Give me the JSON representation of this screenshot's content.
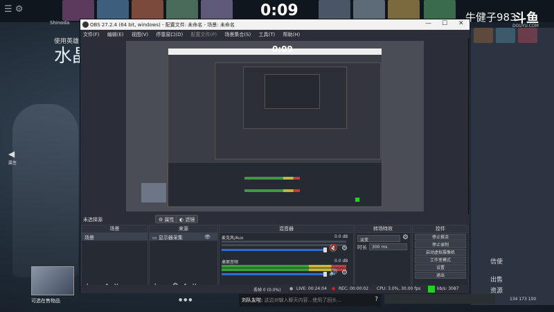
{
  "game": {
    "clock": "0:09",
    "used_hero_label": "使用英雄",
    "hero_name": "水晶",
    "shinoda_label": "Shinoda",
    "left_side_label": "属性",
    "bottom_label": "可选在售物品",
    "right_label_1": "信使",
    "right_label_2": "出售",
    "right_label_3": "资源",
    "right_numbers": "134 173 100"
  },
  "stream": {
    "streamer_name": "牛健子983",
    "platform_logo": "斗鱼",
    "platform_sub": "DOUYU.COM",
    "chat_user": "刘队友啦:",
    "chat_placeholder": "这边对输入聊天内容...使用了回头..."
  },
  "obs": {
    "title": "OBS 27.2.4 (64 bit, windows) - 配置文件: 未命名 - 场景: 未命名",
    "menu": [
      "文件(F)",
      "编辑(E)",
      "视图(V)",
      "停靠窗口(D)",
      "配置文件(P)",
      "场景集合(S)",
      "工具(T)",
      "帮助(H)"
    ],
    "nosource": "未选择源",
    "properties_btn": "属性",
    "filters_btn": "滤镜",
    "docks": {
      "scenes_title": "场景",
      "scenes_items": [
        "场景"
      ],
      "sources_title": "来源",
      "sources_items": [
        "显示器采集"
      ],
      "mixer_title": "混音器",
      "transitions_title": "转场特效",
      "controls_title": "控件"
    },
    "mixer": [
      {
        "name": "麦克风/Aux",
        "db": "0.0 dB",
        "muted": true
      },
      {
        "name": "桌面音频",
        "db": "0.0 dB",
        "muted": false
      }
    ],
    "transitions": {
      "type": "淡变",
      "duration_label": "时长",
      "duration_value": "300 ms"
    },
    "controls": [
      "停止推流",
      "停止录制",
      "启动虚拟摄像机",
      "工作室模式",
      "设置",
      "退出"
    ],
    "status": {
      "dropped": "丢帧 0 (0.0%)",
      "live": "LIVE: 00:24:04",
      "rec": "REC: 00:00:02",
      "cpu": "CPU: 3.0%, 30.00 fps",
      "bitrate": "kb/s: 3087"
    },
    "nested_clock": "0:09",
    "colors": {
      "accent_green": "#1ed51e",
      "mute_red": "#d62020",
      "fader_blue": "#2d6fd6"
    }
  }
}
